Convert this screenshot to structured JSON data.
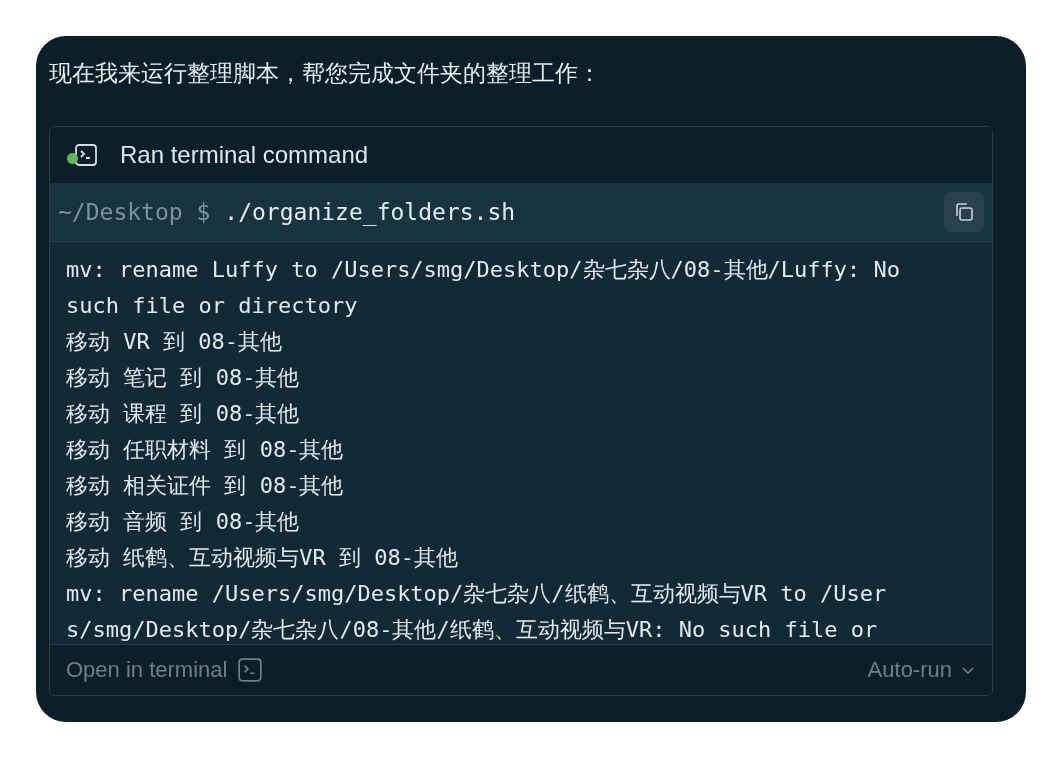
{
  "message": "现在我来运行整理脚本，帮您完成文件夹的整理工作：",
  "tool_call": {
    "title": "Ran terminal command",
    "succeeded": true,
    "prompt": "~/Desktop $",
    "command": "./organize_folders.sh",
    "output_lines": [
      "mv: rename Luffy to /Users/smg/Desktop/杂七杂八/08-其他/Luffy: No",
      "such file or directory",
      "移动 VR 到 08-其他",
      "移动 笔记 到 08-其他",
      "移动 课程 到 08-其他",
      "移动 任职材料 到 08-其他",
      "移动 相关证件 到 08-其他",
      "移动 音频 到 08-其他",
      "移动 纸鹤、互动视频与VR 到 08-其他",
      "mv: rename /Users/smg/Desktop/杂七杂八/纸鹤、互动视频与VR to /User",
      "s/smg/Desktop/杂七杂八/08-其他/纸鹤、互动视频与VR: No such file or"
    ],
    "open_link": "Open in terminal",
    "run_mode": "Auto-run"
  }
}
